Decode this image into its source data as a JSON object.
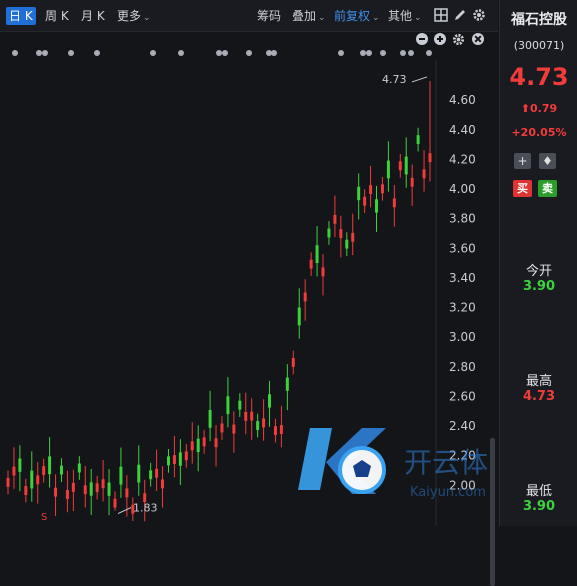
{
  "toolbar": {
    "periods": [
      "日 K",
      "周 K",
      "月 K",
      "更多"
    ],
    "tools": [
      "筹码",
      "叠加",
      "前复权",
      "其他"
    ]
  },
  "chart_data": {
    "type": "candlestick",
    "ylim": [
      1.8,
      4.75
    ],
    "y_ticks": [
      "4.60",
      "4.40",
      "4.20",
      "4.00",
      "3.80",
      "3.60",
      "3.40",
      "3.20",
      "3.00",
      "2.80",
      "2.60",
      "2.40",
      "2.20",
      "2.00"
    ],
    "y_tick_values": [
      4.6,
      4.4,
      4.2,
      4.0,
      3.8,
      3.6,
      3.4,
      3.2,
      3.0,
      2.8,
      2.6,
      2.4,
      2.2,
      2.0
    ],
    "annotations": {
      "high": "4.73",
      "low": "1.83",
      "marker": "S"
    },
    "high_value": 4.73,
    "low_value": 1.83
  },
  "stock": {
    "name": "福石控股",
    "code": "(300071)",
    "price": "4.73",
    "change": "0.79",
    "change_pct": "+20.05%",
    "buy": "买",
    "sell": "卖",
    "open_label": "今开",
    "open": "3.90",
    "high_label": "最高",
    "high": "4.73",
    "low_label": "最低",
    "low": "3.90"
  },
  "watermark": {
    "text": "开云体育",
    "sub": "Kaiyun.com"
  },
  "colors": {
    "up": "#f23b3b",
    "down": "#3cd23c",
    "accent": "#1f6fd6",
    "background": "#141519"
  }
}
